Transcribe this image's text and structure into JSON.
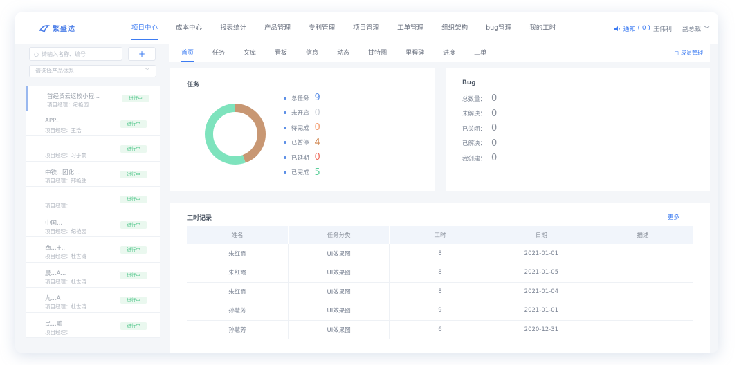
{
  "app": {
    "name": "繁盛达"
  },
  "nav": {
    "items": [
      "项目中心",
      "成本中心",
      "报表统计",
      "产品管理",
      "专利管理",
      "项目管理",
      "工单管理",
      "组织架构",
      "bug管理",
      "我的工时"
    ],
    "active_index": 0
  },
  "header": {
    "notice_label": "通知",
    "notice_count": "( 0 )",
    "user_name": "王伟利",
    "user_role": "副总裁"
  },
  "sidebar": {
    "search_placeholder": "请输入名称、编号",
    "add_label": "+",
    "product_select_placeholder": "请选择产品体系",
    "projects": [
      {
        "name": "首经贸云返校小程...",
        "manager": "项目经理：纪艳园",
        "status": "进行中"
      },
      {
        "name": "APP...",
        "manager": "项目经理：王浩",
        "status": "进行中"
      },
      {
        "name": "",
        "manager": "项目经理：习于豪",
        "status": "进行中"
      },
      {
        "name": "中铁...团化...",
        "manager": "项目经理：邢艳胜",
        "status": "进行中"
      },
      {
        "name": "",
        "manager": "项目经理：",
        "status": "进行中"
      },
      {
        "name": "中国...",
        "manager": "项目经理：纪艳园",
        "status": "进行中"
      },
      {
        "name": "西...+...",
        "manager": "项目经理：杜世涛",
        "status": "进行中"
      },
      {
        "name": "晨...A...",
        "manager": "项目经理：杜世涛",
        "status": "进行中"
      },
      {
        "name": "九...A",
        "manager": "项目经理：杜世涛",
        "status": "进行中"
      },
      {
        "name": "民...融",
        "manager": "项目经理：",
        "status": "进行中"
      }
    ]
  },
  "subtabs": {
    "items": [
      "首页",
      "任务",
      "文库",
      "看板",
      "信息",
      "动态",
      "甘特图",
      "里程碑",
      "进度",
      "工单"
    ],
    "active_index": 0,
    "member_mgmt_label": "成员管理"
  },
  "task": {
    "title": "任务",
    "stats": [
      {
        "label": "总任务",
        "value": "9",
        "color": "#5c8fe6"
      },
      {
        "label": "未开启",
        "value": "0",
        "color": "#c9ced6"
      },
      {
        "label": "待完成",
        "value": "0",
        "color": "#f39a6b"
      },
      {
        "label": "已暂停",
        "value": "4",
        "color": "#d0854e"
      },
      {
        "label": "已延期",
        "value": "0",
        "color": "#ef6a5a"
      },
      {
        "label": "已完成",
        "value": "5",
        "color": "#5ccf9a"
      }
    ],
    "donut_colors": {
      "paused": "#c89773",
      "done": "#7ee3bd"
    }
  },
  "bug": {
    "title": "Bug",
    "rows": [
      {
        "label": "总数量：",
        "value": "0"
      },
      {
        "label": "未解决：",
        "value": "0"
      },
      {
        "label": "已关闭：",
        "value": "0"
      },
      {
        "label": "已解决：",
        "value": "0"
      },
      {
        "label": "我创建：",
        "value": "0"
      }
    ]
  },
  "worklog": {
    "title": "工时记录",
    "more_label": "更多",
    "columns": [
      "姓名",
      "任务分类",
      "工时",
      "日期",
      "描述"
    ],
    "rows": [
      [
        "朱红霞",
        "UI效果图",
        "8",
        "2021-01-01",
        ""
      ],
      [
        "朱红霞",
        "UI效果图",
        "8",
        "2021-01-05",
        ""
      ],
      [
        "朱红霞",
        "UI效果图",
        "8",
        "2021-01-04",
        ""
      ],
      [
        "孙慧芳",
        "UI效果图",
        "9",
        "2021-01-01",
        ""
      ],
      [
        "孙慧芳",
        "UI效果图",
        "6",
        "2020-12-31",
        ""
      ]
    ]
  }
}
